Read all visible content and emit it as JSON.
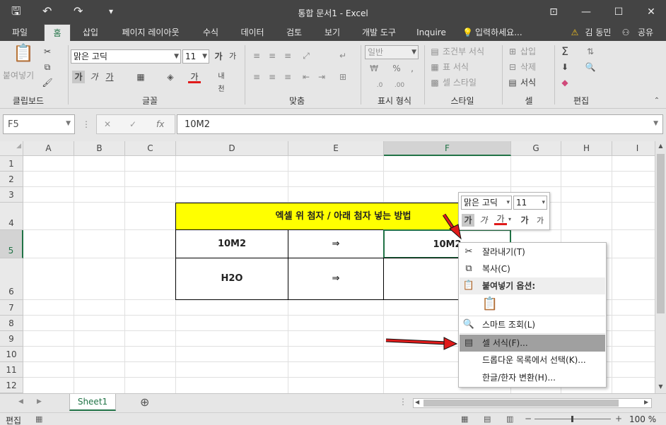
{
  "window": {
    "title": "통합 문서1 - Excel",
    "qat": {
      "save": "🖫",
      "undo": "↶",
      "redo": "↷",
      "customize": "▾"
    },
    "buttons": {
      "ribbon_display": "⊡",
      "minimize": "—",
      "maximize": "☐",
      "close": "✕"
    }
  },
  "tabs": [
    "파일",
    "홈",
    "삽입",
    "페이지 레이아웃",
    "수식",
    "데이터",
    "검토",
    "보기",
    "개발 도구",
    "Inquire"
  ],
  "tell_me": "입력하세요...",
  "account": {
    "warning": "⚠",
    "user": "김 동민",
    "share": "공유"
  },
  "ribbon": {
    "groups": [
      "클립보드",
      "글꼴",
      "맞춤",
      "표시 형식",
      "스타일",
      "셀",
      "편집"
    ],
    "clipboard": {
      "paste": "붙여넣기"
    },
    "font": {
      "name": "맑은 고딕",
      "size": "11",
      "bold": "가",
      "italic": "가",
      "underline": "가",
      "font_color_glyph": "가"
    },
    "number": {
      "format": "일반",
      "percent": "%",
      "comma": ","
    },
    "styles": {
      "conditional": "조건부 서식",
      "table": "표 서식",
      "cell": "셀 스타일"
    },
    "cells": {
      "insert": "삽입",
      "delete": "삭제",
      "format": "서식"
    },
    "editing": {
      "sum": "Σ"
    }
  },
  "formula_bar": {
    "name_box": "F5",
    "fx": "fx",
    "cancel": "✕",
    "enter": "✓",
    "content": "10M2"
  },
  "columns": [
    "A",
    "B",
    "C",
    "D",
    "E",
    "F",
    "G",
    "H",
    "I"
  ],
  "rows": [
    "1",
    "2",
    "3",
    "4",
    "5",
    "6",
    "7",
    "8",
    "9",
    "10",
    "11",
    "12"
  ],
  "sheet_cells": {
    "title": "엑셀 위 첨자 / 아래 첨자 넣는 방법",
    "d5": "10M2",
    "e5": "⇒",
    "f5": "10M2",
    "d6": "H2O",
    "e6": "⇒"
  },
  "mini_toolbar": {
    "font": "맑은 고딕",
    "size": "11",
    "bold": "가",
    "italic": "가",
    "color": "가",
    "grow": "가",
    "shrink": "가"
  },
  "context_menu": {
    "cut": "잘라내기(T)",
    "copy": "복사(C)",
    "paste_options": "붙여넣기 옵션:",
    "smart_lookup": "스마트 조회(L)",
    "format_cells": "셀 서식(F)...",
    "pick_list": "드롭다운 목록에서 선택(K)...",
    "hangul_hanja": "한글/한자 변환(H)..."
  },
  "sheet_tab": "Sheet1",
  "status": {
    "mode": "편집",
    "zoom": "100 %"
  },
  "colors": {
    "accent": "#217346",
    "title_fill": "#ffff00",
    "arrow": "#e01b1b",
    "dark_bar": "#444444"
  }
}
